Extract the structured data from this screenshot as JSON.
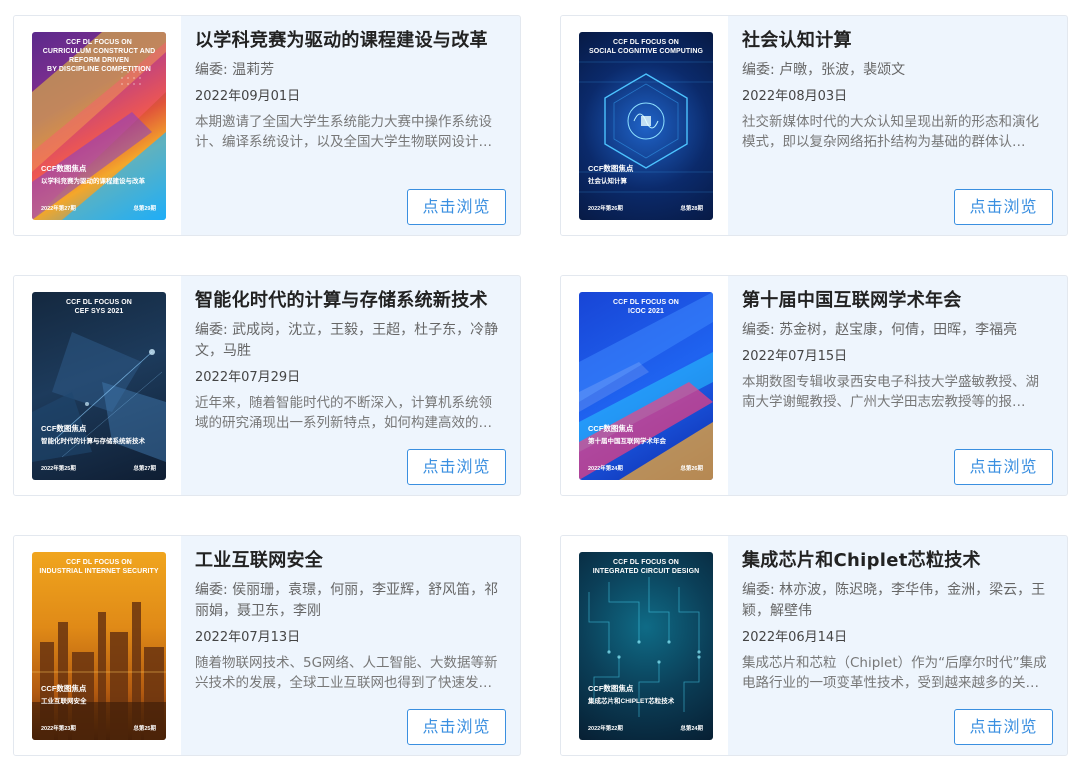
{
  "button_label": "点击浏览",
  "editors_prefix": "编委: ",
  "cards": [
    {
      "title": "以学科竞赛为驱动的课程建设与改革",
      "editors": "温莉芳",
      "date": "2022年09月01日",
      "desc": "本期邀请了全国大学生系统能力大赛中操作系统设计、编译系统设计，以及全国大学生物联网设计竞赛的相关专家……",
      "cover": {
        "top_title": "CCF DL FOCUS ON\nCURRICULUM CONSTRUCT AND REFORM DRIVEN\nBY DISCIPLINE COMPETITION",
        "series": "CCF数图焦点",
        "cn_title": "以学科竞赛为驱动的课程建设与改革",
        "issue": "2022年第27期",
        "total": "总第29期"
      }
    },
    {
      "title": "社会认知计算",
      "editors": "卢暾，张波，裴颂文",
      "date": "2022年08月03日",
      "desc": "社交新媒体时代的大众认知呈现出新的形态和演化模式，即以复杂网络拓扑结构为基础的群体认知……",
      "cover": {
        "top_title": "CCF DL FOCUS ON\nSOCIAL COGNITIVE COMPUTING",
        "series": "CCF数图焦点",
        "cn_title": "社会认知计算",
        "issue": "2022年第26期",
        "total": "总第28期"
      }
    },
    {
      "title": "智能化时代的计算与存储系统新技术",
      "editors": "武成岗，沈立，王毅，王超，杜子东，冷静文，马胜",
      "date": "2022年07月29日",
      "desc": "近年来，随着智能时代的不断深入，计算机系统领域的研究涌现出一系列新特点，如何构建高效的系统……",
      "cover": {
        "top_title": "CCF DL FOCUS ON\nCEF SYS 2021",
        "series": "CCF数图焦点",
        "cn_title": "智能化时代的计算与存储系统新技术",
        "issue": "2022年第25期",
        "total": "总第27期"
      }
    },
    {
      "title": "第十届中国互联网学术年会",
      "editors": "苏金树，赵宝康，何倩，田晖，李福亮",
      "date": "2022年07月15日",
      "desc": "本期数图专辑收录西安电子科技大学盛敏教授、湖南大学谢鲲教授、广州大学田志宏教授等的报告……",
      "cover": {
        "top_title": "CCF DL FOCUS ON\nICOC 2021",
        "series": "CCF数图焦点",
        "cn_title": "第十届中国互联网学术年会",
        "issue": "2022年第24期",
        "total": "总第26期"
      }
    },
    {
      "title": "工业互联网安全",
      "editors": "侯丽珊，袁璟，何丽，李亚辉，舒风笛，祁丽娟，聂卫东，李刚",
      "date": "2022年07月13日",
      "desc": "随着物联网技术、5G网络、人工智能、大数据等新兴技术的发展，全球工业互联网也得到了快速发展……",
      "cover": {
        "top_title": "CCF DL FOCUS ON\nINDUSTRIAL INTERNET SECURITY",
        "series": "CCF数图焦点",
        "cn_title": "工业互联网安全",
        "issue": "2022年第23期",
        "total": "总第25期"
      }
    },
    {
      "title": "集成芯片和Chiplet芯粒技术",
      "editors": "林亦波，陈迟晓，李华伟，金洲，梁云，王颖，解壁伟",
      "date": "2022年06月14日",
      "desc": "集成芯片和芯粒（Chiplet）作为“后摩尔时代”集成电路行业的一项变革性技术，受到越来越多的关注……",
      "cover": {
        "top_title": "CCF DL FOCUS ON\nINTEGRATED CIRCUIT DESIGN",
        "series": "CCF数图焦点",
        "cn_title": "集成芯片和CHIPLET芯粒技术",
        "issue": "2022年第22期",
        "total": "总第24期"
      }
    }
  ]
}
